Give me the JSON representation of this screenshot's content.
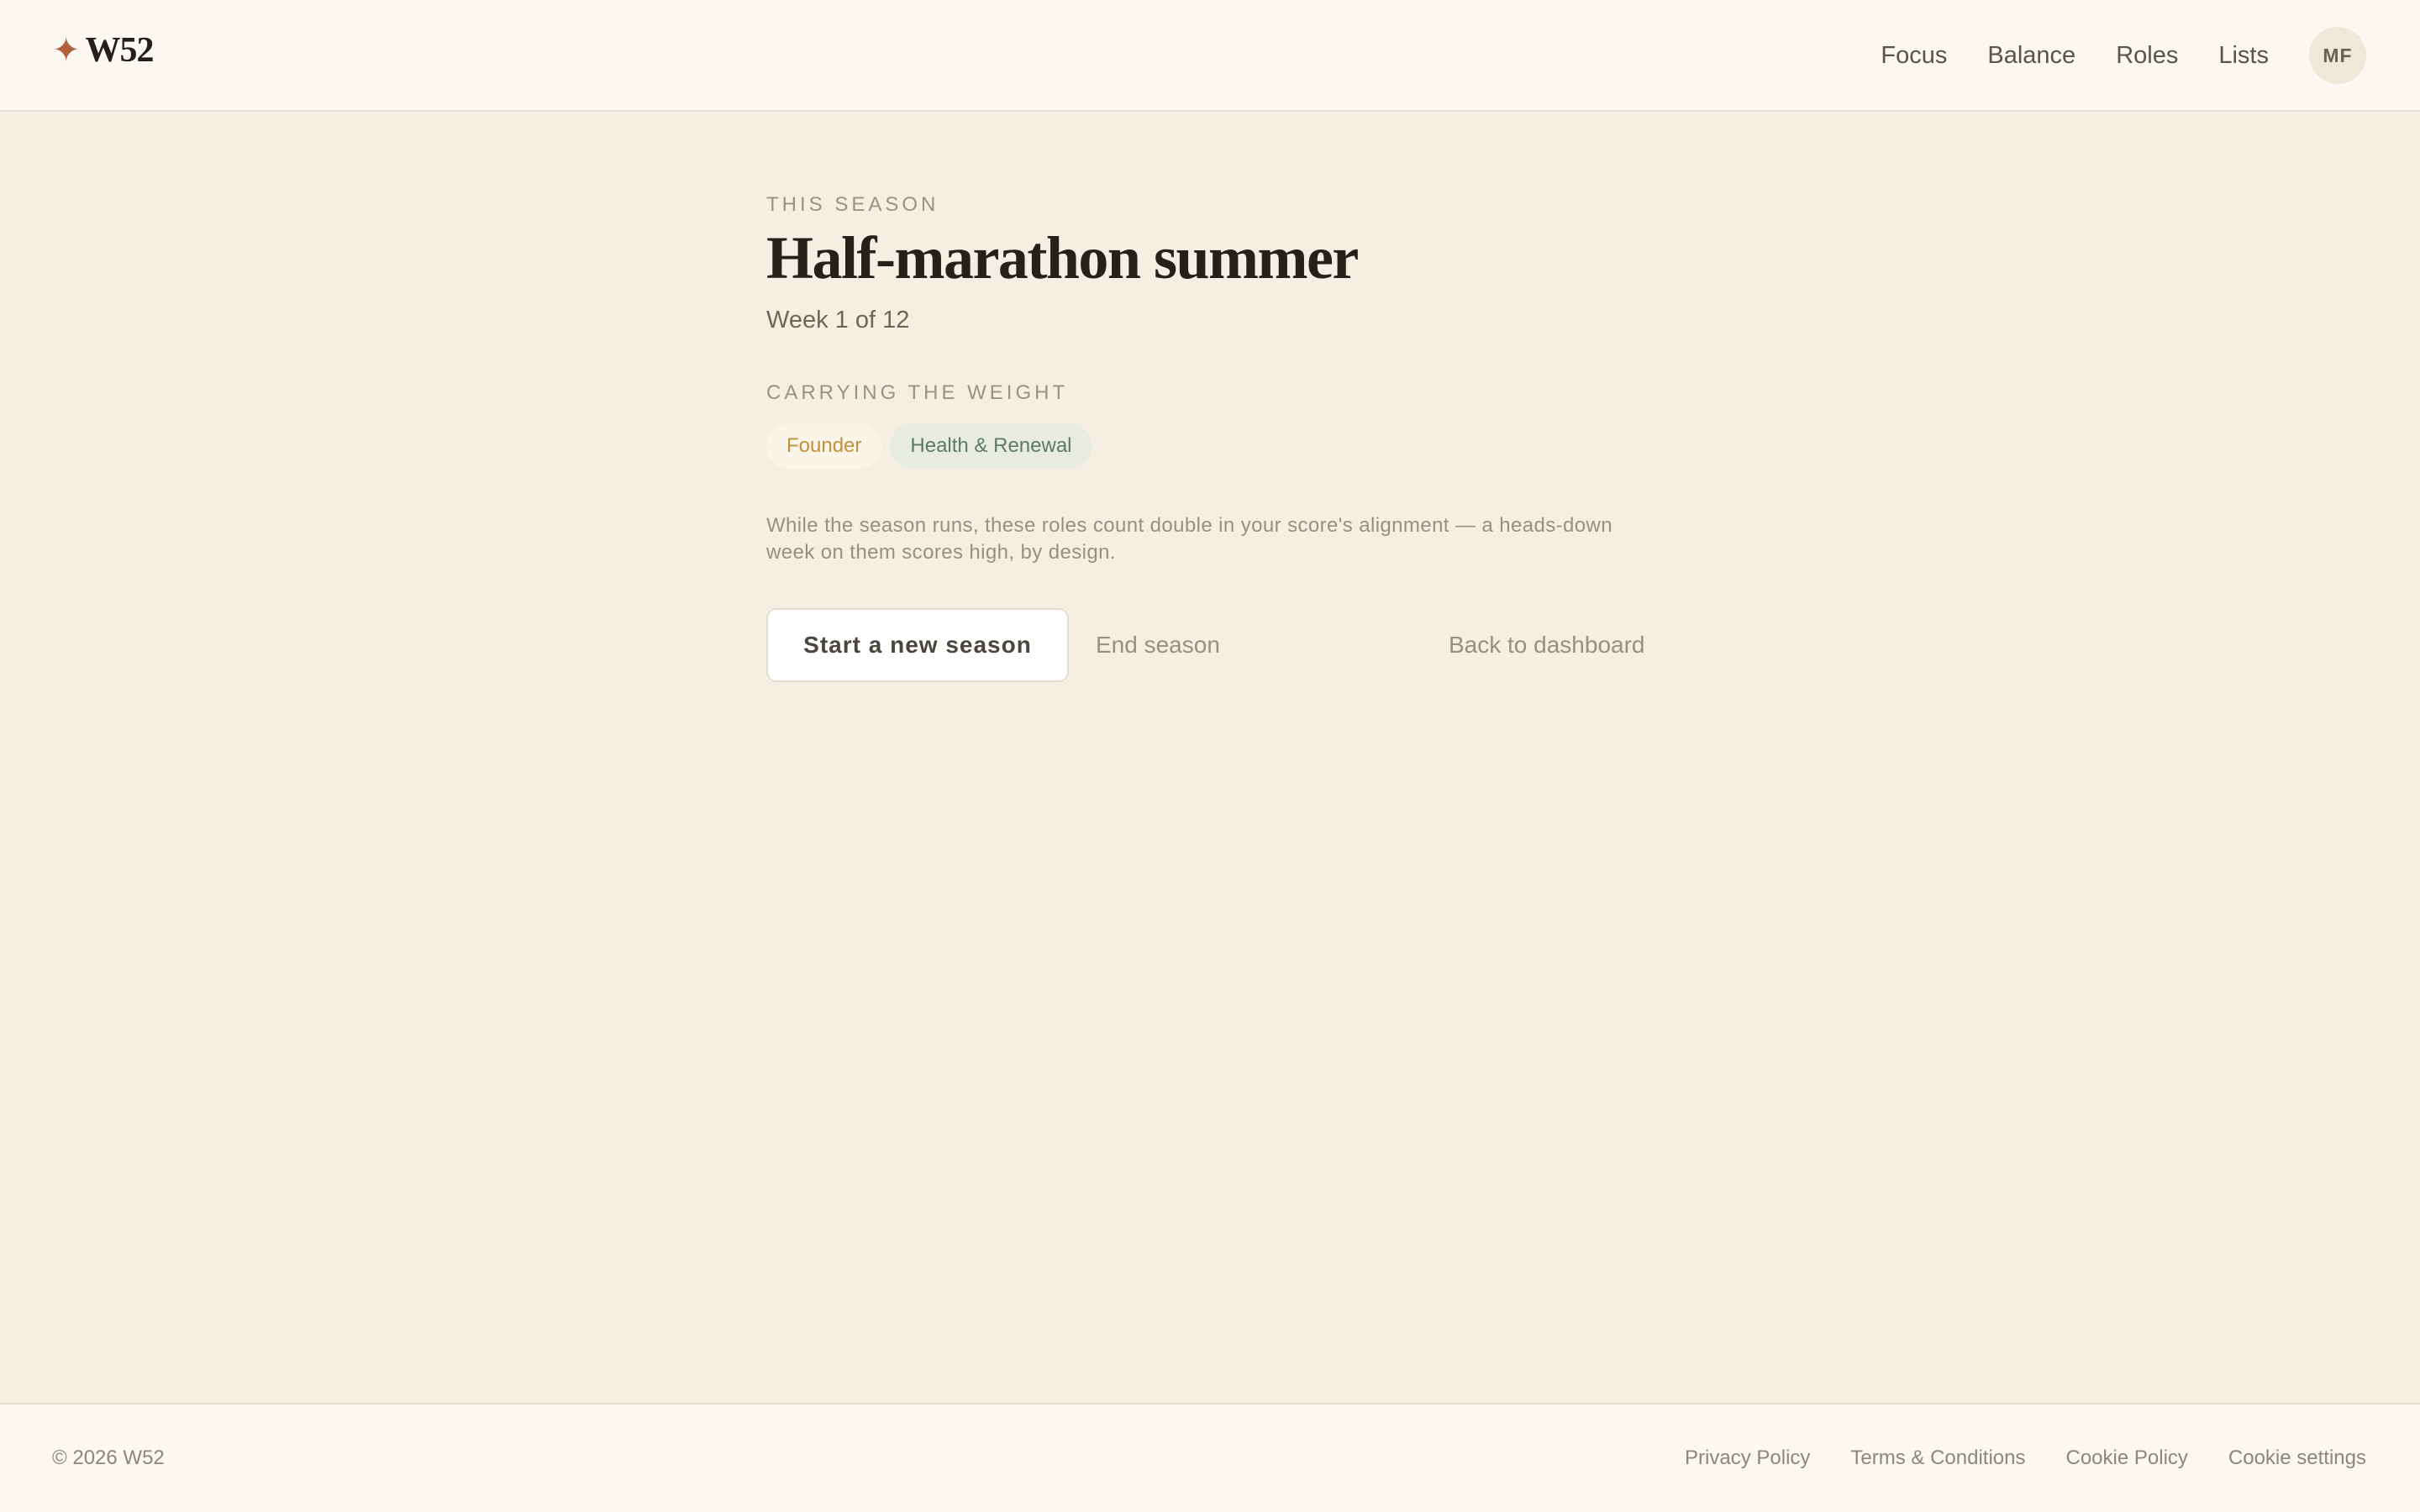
{
  "header": {
    "logo_mark": "✦",
    "logo_text": "W52",
    "nav": [
      "Focus",
      "Balance",
      "Roles",
      "Lists"
    ],
    "avatar_initials": "MF"
  },
  "season": {
    "eyebrow": "THIS SEASON",
    "title": "Half-marathon summer",
    "progress": "Week 1 of 12",
    "weight_label": "CARRYING THE WEIGHT",
    "roles": [
      "Founder",
      "Health & Renewal"
    ],
    "description": "While the season runs, these roles count double in your score's alignment — a heads-down week on them scores high, by design."
  },
  "actions": {
    "primary": "Start a new season",
    "end": "End season",
    "back": "Back to dashboard"
  },
  "footer": {
    "copyright": "© 2026 W52",
    "links": [
      "Privacy Policy",
      "Terms & Conditions",
      "Cookie Policy",
      "Cookie settings"
    ]
  },
  "colors": {
    "background": "#f5efe3",
    "surface": "#fbf8f1",
    "accent_star": "#b0603c",
    "founder_chip_text": "#c0913c",
    "health_chip_text": "#5e7a62"
  }
}
